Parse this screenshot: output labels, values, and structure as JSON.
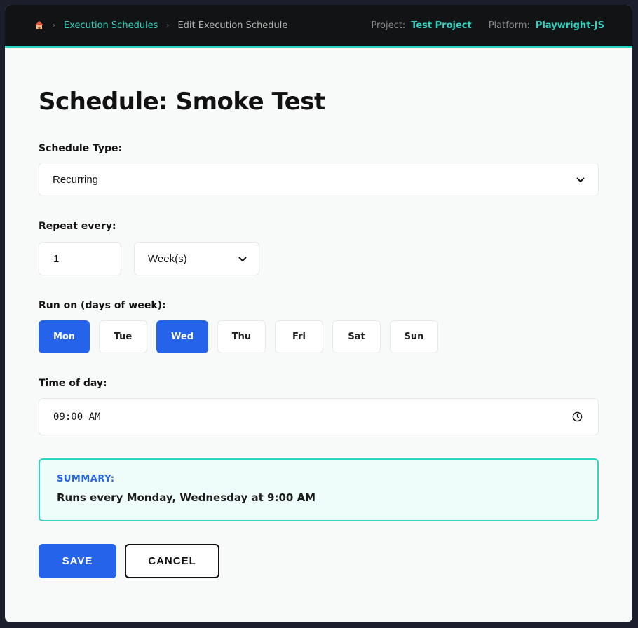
{
  "breadcrumb": {
    "home_icon": "home-icon",
    "items": [
      "Execution Schedules",
      "Edit Execution Schedule"
    ]
  },
  "meta": {
    "project_label": "Project:",
    "project_value": "Test Project",
    "platform_label": "Platform:",
    "platform_value": "Playwright-JS"
  },
  "page": {
    "title": "Schedule: Smoke Test"
  },
  "schedule_type": {
    "label": "Schedule Type:",
    "value": "Recurring"
  },
  "repeat": {
    "label": "Repeat every:",
    "interval": "1",
    "unit": "Week(s)"
  },
  "days": {
    "label": "Run on (days of week):",
    "items": [
      {
        "label": "Mon",
        "selected": true
      },
      {
        "label": "Tue",
        "selected": false
      },
      {
        "label": "Wed",
        "selected": true
      },
      {
        "label": "Thu",
        "selected": false
      },
      {
        "label": "Fri",
        "selected": false
      },
      {
        "label": "Sat",
        "selected": false
      },
      {
        "label": "Sun",
        "selected": false
      }
    ]
  },
  "time": {
    "label": "Time of day:",
    "value": "09:00 AM"
  },
  "summary": {
    "title": "SUMMARY:",
    "text": "Runs every Monday, Wednesday at 9:00 AM"
  },
  "actions": {
    "save": "SAVE",
    "cancel": "CANCEL"
  },
  "colors": {
    "accent": "#2dd4bf",
    "primary": "#2563eb",
    "topbar": "#111315"
  }
}
